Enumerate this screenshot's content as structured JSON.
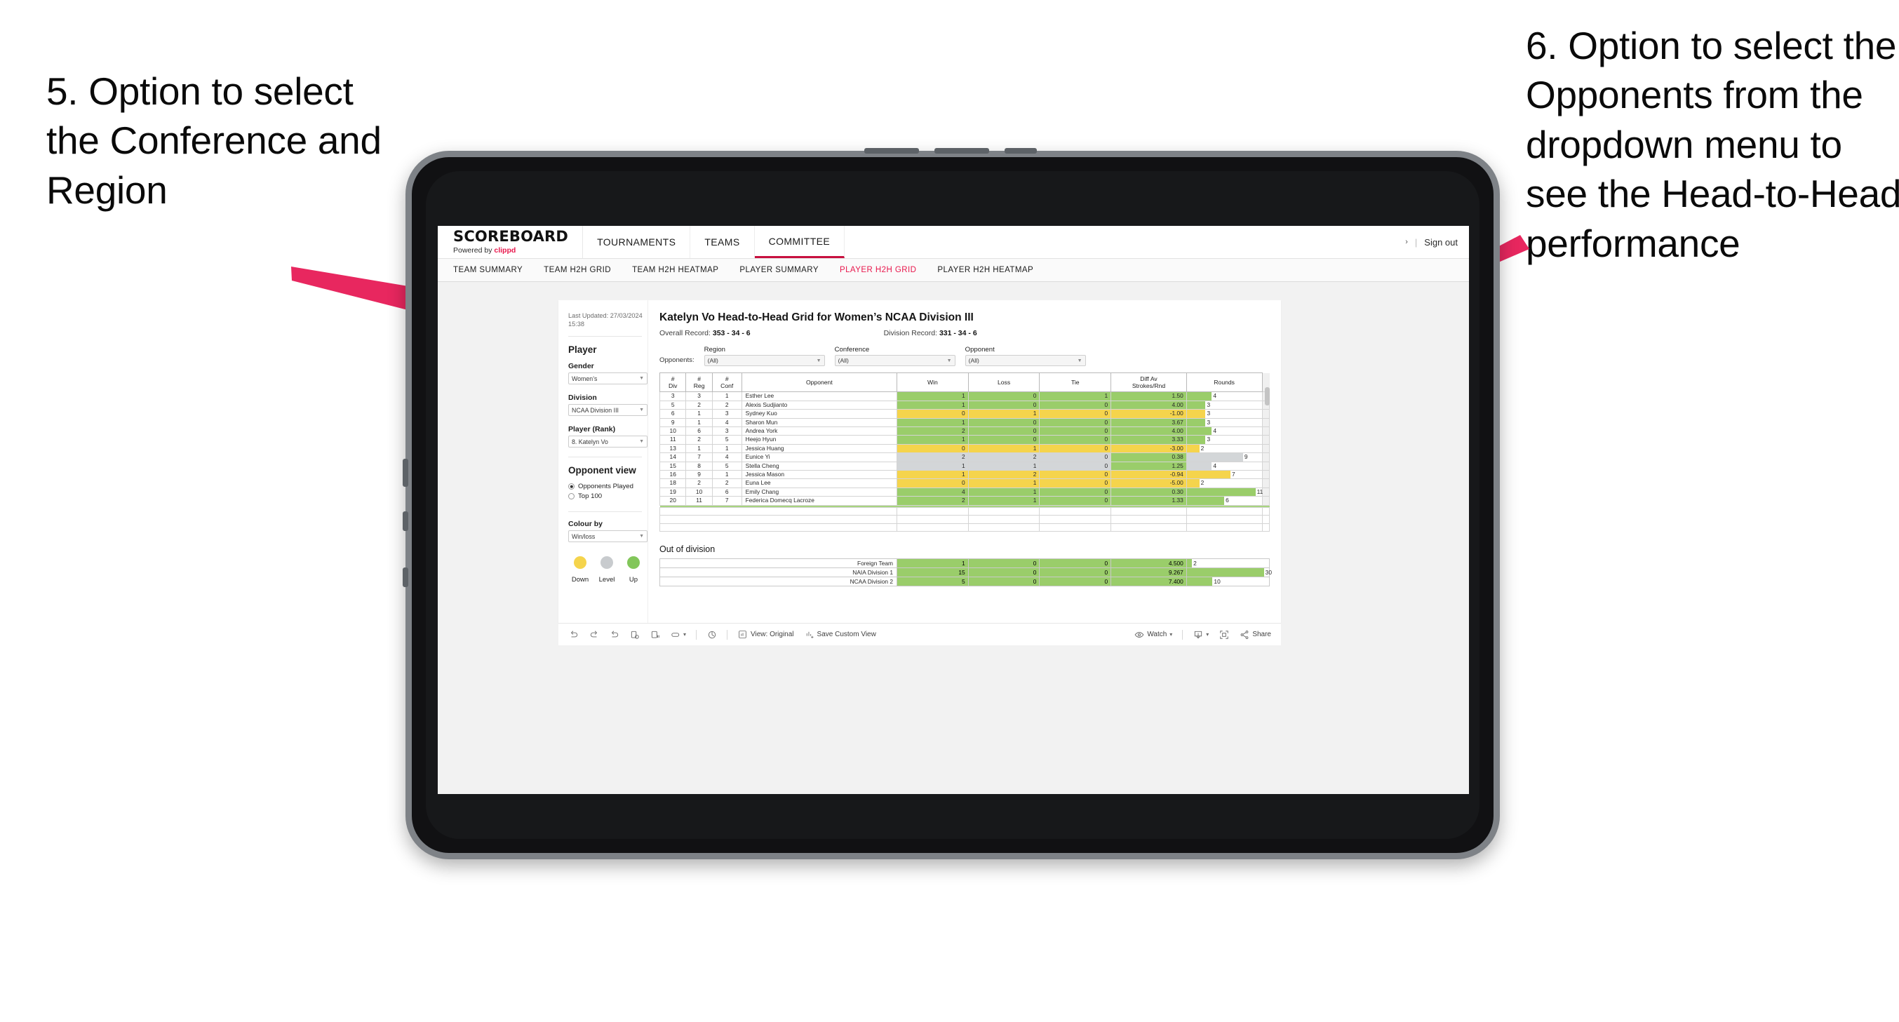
{
  "annotations": {
    "left": "5. Option to select the Conference and Region",
    "right": "6. Option to select the Opponents from the dropdown menu to see the Head-to-Head performance"
  },
  "topnav": {
    "brand_title": "SCOREBOARD",
    "brand_sub_prefix": "Powered by ",
    "brand_sub_name": "clippd",
    "items": [
      {
        "label": "TOURNAMENTS",
        "active": false
      },
      {
        "label": "TEAMS",
        "active": false
      },
      {
        "label": "COMMITTEE",
        "active": true
      }
    ],
    "chevron": "›",
    "separator": "|",
    "signout": "Sign out"
  },
  "subnav": {
    "items": [
      {
        "label": "TEAM SUMMARY",
        "active": false
      },
      {
        "label": "TEAM H2H GRID",
        "active": false
      },
      {
        "label": "TEAM H2H HEATMAP",
        "active": false
      },
      {
        "label": "PLAYER SUMMARY",
        "active": false
      },
      {
        "label": "PLAYER H2H GRID",
        "active": true
      },
      {
        "label": "PLAYER H2H HEATMAP",
        "active": false
      }
    ]
  },
  "sidebar": {
    "last_updated": "Last Updated: 27/03/2024 15:38",
    "player_heading": "Player",
    "fields": [
      {
        "label": "Gender",
        "value": "Women’s"
      },
      {
        "label": "Division",
        "value": "NCAA Division III"
      },
      {
        "label": "Player (Rank)",
        "value": "8. Katelyn Vo"
      }
    ],
    "opponent_view_heading": "Opponent view",
    "opponent_view_options": [
      {
        "label": "Opponents Played",
        "selected": true
      },
      {
        "label": "Top 100",
        "selected": false
      }
    ],
    "colour_by_label": "Colour by",
    "colour_by_value": "Win/loss",
    "legend": [
      {
        "label": "Down",
        "color": "#f5d44c"
      },
      {
        "label": "Level",
        "color": "#c8cbce"
      },
      {
        "label": "Up",
        "color": "#82c65a"
      }
    ]
  },
  "main": {
    "title": "Katelyn Vo Head-to-Head Grid for Women’s NCAA Division III",
    "overall_record_label": "Overall Record:",
    "overall_record_value": "353 - 34 - 6",
    "division_record_label": "Division Record:",
    "division_record_value": "331 - 34 - 6",
    "opponents_label": "Opponents:",
    "filters": [
      {
        "name": "Region",
        "value": "(All)"
      },
      {
        "name": "Conference",
        "value": "(All)"
      },
      {
        "name": "Opponent",
        "value": "(All)"
      }
    ]
  },
  "chart_data": {
    "type": "table",
    "title": "Katelyn Vo Head-to-Head Grid for Women’s NCAA Division III",
    "columns": [
      "# Div",
      "# Reg",
      "# Conf",
      "Opponent",
      "Win",
      "Loss",
      "Tie",
      "Diff Av Strokes/Rnd",
      "Rounds"
    ],
    "rounds_max": 12,
    "rows": [
      {
        "div": "3",
        "reg": "3",
        "conf": "1",
        "opponent": "Esther Lee",
        "win": "1",
        "loss": "0",
        "tie": "1",
        "diff": "1.50",
        "rounds": "4",
        "color": "#9acd6a"
      },
      {
        "div": "5",
        "reg": "2",
        "conf": "2",
        "opponent": "Alexis Sudjianto",
        "win": "1",
        "loss": "0",
        "tie": "0",
        "diff": "4.00",
        "rounds": "3",
        "color": "#9acd6a"
      },
      {
        "div": "6",
        "reg": "1",
        "conf": "3",
        "opponent": "Sydney Kuo",
        "win": "0",
        "loss": "1",
        "tie": "0",
        "diff": "-1.00",
        "rounds": "3",
        "color": "#f5d44c"
      },
      {
        "div": "9",
        "reg": "1",
        "conf": "4",
        "opponent": "Sharon Mun",
        "win": "1",
        "loss": "0",
        "tie": "0",
        "diff": "3.67",
        "rounds": "3",
        "color": "#9acd6a"
      },
      {
        "div": "10",
        "reg": "6",
        "conf": "3",
        "opponent": "Andrea York",
        "win": "2",
        "loss": "0",
        "tie": "0",
        "diff": "4.00",
        "rounds": "4",
        "color": "#9acd6a"
      },
      {
        "div": "11",
        "reg": "2",
        "conf": "5",
        "opponent": "Heejo Hyun",
        "win": "1",
        "loss": "0",
        "tie": "0",
        "diff": "3.33",
        "rounds": "3",
        "color": "#9acd6a"
      },
      {
        "div": "13",
        "reg": "1",
        "conf": "1",
        "opponent": "Jessica Huang",
        "win": "0",
        "loss": "1",
        "tie": "0",
        "diff": "-3.00",
        "rounds": "2",
        "color": "#f5d44c"
      },
      {
        "div": "14",
        "reg": "7",
        "conf": "4",
        "opponent": "Eunice Yi",
        "win": "2",
        "loss": "2",
        "tie": "0",
        "diff": "0.38",
        "rounds": "9",
        "color": "#d3d6d8",
        "diff_color": "#9acd6a"
      },
      {
        "div": "15",
        "reg": "8",
        "conf": "5",
        "opponent": "Stella Cheng",
        "win": "1",
        "loss": "1",
        "tie": "0",
        "diff": "1.25",
        "rounds": "4",
        "color": "#d3d6d8",
        "diff_color": "#9acd6a"
      },
      {
        "div": "16",
        "reg": "9",
        "conf": "1",
        "opponent": "Jessica Mason",
        "win": "1",
        "loss": "2",
        "tie": "0",
        "diff": "-0.94",
        "rounds": "7",
        "color": "#f5d44c"
      },
      {
        "div": "18",
        "reg": "2",
        "conf": "2",
        "opponent": "Euna Lee",
        "win": "0",
        "loss": "1",
        "tie": "0",
        "diff": "-5.00",
        "rounds": "2",
        "color": "#f5d44c"
      },
      {
        "div": "19",
        "reg": "10",
        "conf": "6",
        "opponent": "Emily Chang",
        "win": "4",
        "loss": "1",
        "tie": "0",
        "diff": "0.30",
        "rounds": "11",
        "color": "#9acd6a"
      },
      {
        "div": "20",
        "reg": "11",
        "conf": "7",
        "opponent": "Federica Domecq Lacroze",
        "win": "2",
        "loss": "1",
        "tie": "0",
        "diff": "1.33",
        "rounds": "6",
        "color": "#9acd6a"
      }
    ],
    "out_of_division_title": "Out of division",
    "out_of_division": [
      {
        "opponent": "Foreign Team",
        "win": "1",
        "loss": "0",
        "tie": "0",
        "diff": "4.500",
        "rounds": "2",
        "color": "#9acd6a"
      },
      {
        "opponent": "NAIA Division 1",
        "win": "15",
        "loss": "0",
        "tie": "0",
        "diff": "9.267",
        "rounds": "30",
        "color": "#9acd6a"
      },
      {
        "opponent": "NCAA Division 2",
        "win": "5",
        "loss": "0",
        "tie": "0",
        "diff": "7.400",
        "rounds": "10",
        "color": "#9acd6a"
      }
    ],
    "ood_rounds_max": 32
  },
  "toolbar": {
    "view_label": "View: Original",
    "save_label": "Save Custom View",
    "watch_label": "Watch",
    "share_label": "Share",
    "caret": "▾",
    "pipe": "|"
  },
  "colors": {
    "accent": "#e8174c",
    "arrow": "#e8275f",
    "up": "#9acd6a",
    "down": "#f5d44c",
    "level": "#d3d6d8"
  }
}
